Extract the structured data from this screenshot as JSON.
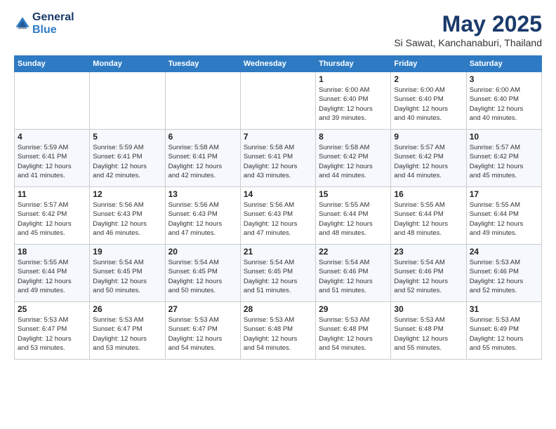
{
  "header": {
    "logo_line1": "General",
    "logo_line2": "Blue",
    "month": "May 2025",
    "location": "Si Sawat, Kanchanaburi, Thailand"
  },
  "weekdays": [
    "Sunday",
    "Monday",
    "Tuesday",
    "Wednesday",
    "Thursday",
    "Friday",
    "Saturday"
  ],
  "weeks": [
    [
      {
        "day": "",
        "info": ""
      },
      {
        "day": "",
        "info": ""
      },
      {
        "day": "",
        "info": ""
      },
      {
        "day": "",
        "info": ""
      },
      {
        "day": "1",
        "info": "Sunrise: 6:00 AM\nSunset: 6:40 PM\nDaylight: 12 hours\nand 39 minutes."
      },
      {
        "day": "2",
        "info": "Sunrise: 6:00 AM\nSunset: 6:40 PM\nDaylight: 12 hours\nand 40 minutes."
      },
      {
        "day": "3",
        "info": "Sunrise: 6:00 AM\nSunset: 6:40 PM\nDaylight: 12 hours\nand 40 minutes."
      }
    ],
    [
      {
        "day": "4",
        "info": "Sunrise: 5:59 AM\nSunset: 6:41 PM\nDaylight: 12 hours\nand 41 minutes."
      },
      {
        "day": "5",
        "info": "Sunrise: 5:59 AM\nSunset: 6:41 PM\nDaylight: 12 hours\nand 42 minutes."
      },
      {
        "day": "6",
        "info": "Sunrise: 5:58 AM\nSunset: 6:41 PM\nDaylight: 12 hours\nand 42 minutes."
      },
      {
        "day": "7",
        "info": "Sunrise: 5:58 AM\nSunset: 6:41 PM\nDaylight: 12 hours\nand 43 minutes."
      },
      {
        "day": "8",
        "info": "Sunrise: 5:58 AM\nSunset: 6:42 PM\nDaylight: 12 hours\nand 44 minutes."
      },
      {
        "day": "9",
        "info": "Sunrise: 5:57 AM\nSunset: 6:42 PM\nDaylight: 12 hours\nand 44 minutes."
      },
      {
        "day": "10",
        "info": "Sunrise: 5:57 AM\nSunset: 6:42 PM\nDaylight: 12 hours\nand 45 minutes."
      }
    ],
    [
      {
        "day": "11",
        "info": "Sunrise: 5:57 AM\nSunset: 6:42 PM\nDaylight: 12 hours\nand 45 minutes."
      },
      {
        "day": "12",
        "info": "Sunrise: 5:56 AM\nSunset: 6:43 PM\nDaylight: 12 hours\nand 46 minutes."
      },
      {
        "day": "13",
        "info": "Sunrise: 5:56 AM\nSunset: 6:43 PM\nDaylight: 12 hours\nand 47 minutes."
      },
      {
        "day": "14",
        "info": "Sunrise: 5:56 AM\nSunset: 6:43 PM\nDaylight: 12 hours\nand 47 minutes."
      },
      {
        "day": "15",
        "info": "Sunrise: 5:55 AM\nSunset: 6:44 PM\nDaylight: 12 hours\nand 48 minutes."
      },
      {
        "day": "16",
        "info": "Sunrise: 5:55 AM\nSunset: 6:44 PM\nDaylight: 12 hours\nand 48 minutes."
      },
      {
        "day": "17",
        "info": "Sunrise: 5:55 AM\nSunset: 6:44 PM\nDaylight: 12 hours\nand 49 minutes."
      }
    ],
    [
      {
        "day": "18",
        "info": "Sunrise: 5:55 AM\nSunset: 6:44 PM\nDaylight: 12 hours\nand 49 minutes."
      },
      {
        "day": "19",
        "info": "Sunrise: 5:54 AM\nSunset: 6:45 PM\nDaylight: 12 hours\nand 50 minutes."
      },
      {
        "day": "20",
        "info": "Sunrise: 5:54 AM\nSunset: 6:45 PM\nDaylight: 12 hours\nand 50 minutes."
      },
      {
        "day": "21",
        "info": "Sunrise: 5:54 AM\nSunset: 6:45 PM\nDaylight: 12 hours\nand 51 minutes."
      },
      {
        "day": "22",
        "info": "Sunrise: 5:54 AM\nSunset: 6:46 PM\nDaylight: 12 hours\nand 51 minutes."
      },
      {
        "day": "23",
        "info": "Sunrise: 5:54 AM\nSunset: 6:46 PM\nDaylight: 12 hours\nand 52 minutes."
      },
      {
        "day": "24",
        "info": "Sunrise: 5:53 AM\nSunset: 6:46 PM\nDaylight: 12 hours\nand 52 minutes."
      }
    ],
    [
      {
        "day": "25",
        "info": "Sunrise: 5:53 AM\nSunset: 6:47 PM\nDaylight: 12 hours\nand 53 minutes."
      },
      {
        "day": "26",
        "info": "Sunrise: 5:53 AM\nSunset: 6:47 PM\nDaylight: 12 hours\nand 53 minutes."
      },
      {
        "day": "27",
        "info": "Sunrise: 5:53 AM\nSunset: 6:47 PM\nDaylight: 12 hours\nand 54 minutes."
      },
      {
        "day": "28",
        "info": "Sunrise: 5:53 AM\nSunset: 6:48 PM\nDaylight: 12 hours\nand 54 minutes."
      },
      {
        "day": "29",
        "info": "Sunrise: 5:53 AM\nSunset: 6:48 PM\nDaylight: 12 hours\nand 54 minutes."
      },
      {
        "day": "30",
        "info": "Sunrise: 5:53 AM\nSunset: 6:48 PM\nDaylight: 12 hours\nand 55 minutes."
      },
      {
        "day": "31",
        "info": "Sunrise: 5:53 AM\nSunset: 6:49 PM\nDaylight: 12 hours\nand 55 minutes."
      }
    ]
  ]
}
